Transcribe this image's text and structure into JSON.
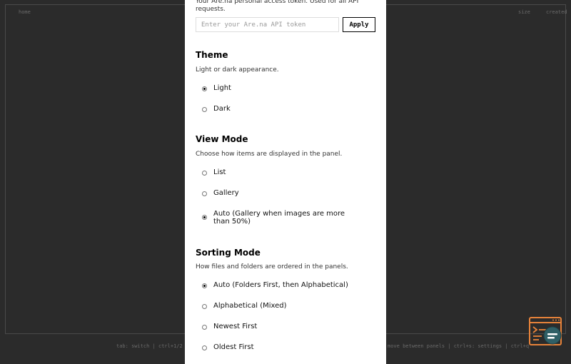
{
  "background": {
    "left_panel_title": "home",
    "right_panel_labels": [
      "size",
      "created"
    ],
    "status_left": "tab: switch  |  ctrl+1/2",
    "status_right": "move between panels  |  ctrl+s: settings  |  ctrl+q"
  },
  "settings": {
    "token": {
      "description": "Your Are.na personal access token. Used for all API requests.",
      "placeholder": "Enter your Are.na API token",
      "apply_label": "Apply"
    },
    "theme": {
      "title": "Theme",
      "description": "Light or dark appearance.",
      "options": [
        {
          "label": "Light",
          "checked": true
        },
        {
          "label": "Dark",
          "checked": false
        }
      ]
    },
    "view_mode": {
      "title": "View Mode",
      "description": "Choose how items are displayed in the panel.",
      "options": [
        {
          "label": "List",
          "checked": false
        },
        {
          "label": "Gallery",
          "checked": false
        },
        {
          "label": "Auto (Gallery when images are more than 50%)",
          "checked": true
        }
      ]
    },
    "sorting_mode": {
      "title": "Sorting Mode",
      "description": "How files and folders are ordered in the panels.",
      "options": [
        {
          "label": "Auto (Folders First, then Alphabetical)",
          "checked": true
        },
        {
          "label": "Alphabetical (Mixed)",
          "checked": false
        },
        {
          "label": "Newest First",
          "checked": false
        },
        {
          "label": "Oldest First",
          "checked": false
        }
      ]
    }
  },
  "colors": {
    "overlay": "#2b2b2b",
    "modal": "#ffffff",
    "brand_orange": "#e8833a",
    "brand_teal": "#2f5f66"
  },
  "icons": {
    "brand": "terminal-window-icon"
  }
}
